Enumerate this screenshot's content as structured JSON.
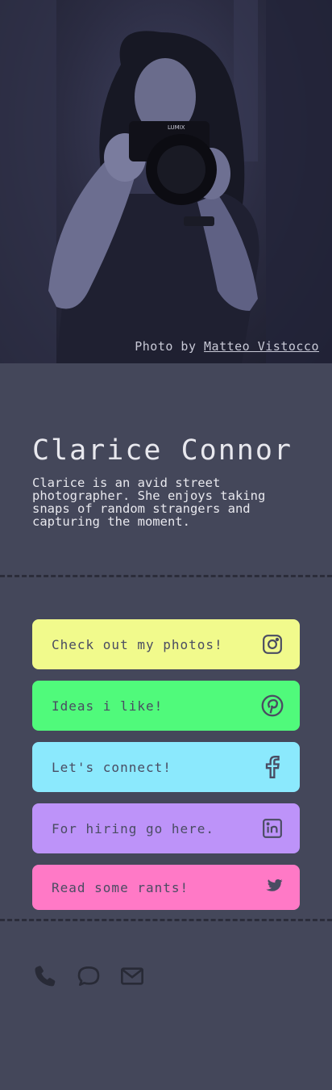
{
  "hero": {
    "credit_prefix": "Photo by ",
    "credit_author": "Matteo Vistocco",
    "camera_brand": "LUMIX"
  },
  "profile": {
    "name": "Clarice Connor",
    "bio": "Clarice is an avid street photographer. She enjoys taking snaps of random strangers and capturing the moment."
  },
  "links": [
    {
      "label": "Check out my photos!",
      "icon": "instagram-icon",
      "color": "#f1fa8c"
    },
    {
      "label": "Ideas i like!",
      "icon": "pinterest-icon",
      "color": "#50fa7b"
    },
    {
      "label": "Let's connect!",
      "icon": "facebook-icon",
      "color": "#8be9fd"
    },
    {
      "label": "For hiring go here.",
      "icon": "linkedin-icon",
      "color": "#bd93f9"
    },
    {
      "label": "Read some rants!",
      "icon": "twitter-icon",
      "color": "#ff79c6"
    }
  ],
  "contact": [
    "phone-icon",
    "chat-icon",
    "mail-icon"
  ],
  "colors": {
    "background": "#44475a",
    "text": "#f8f8f2",
    "icon_dark": "#282a36"
  }
}
